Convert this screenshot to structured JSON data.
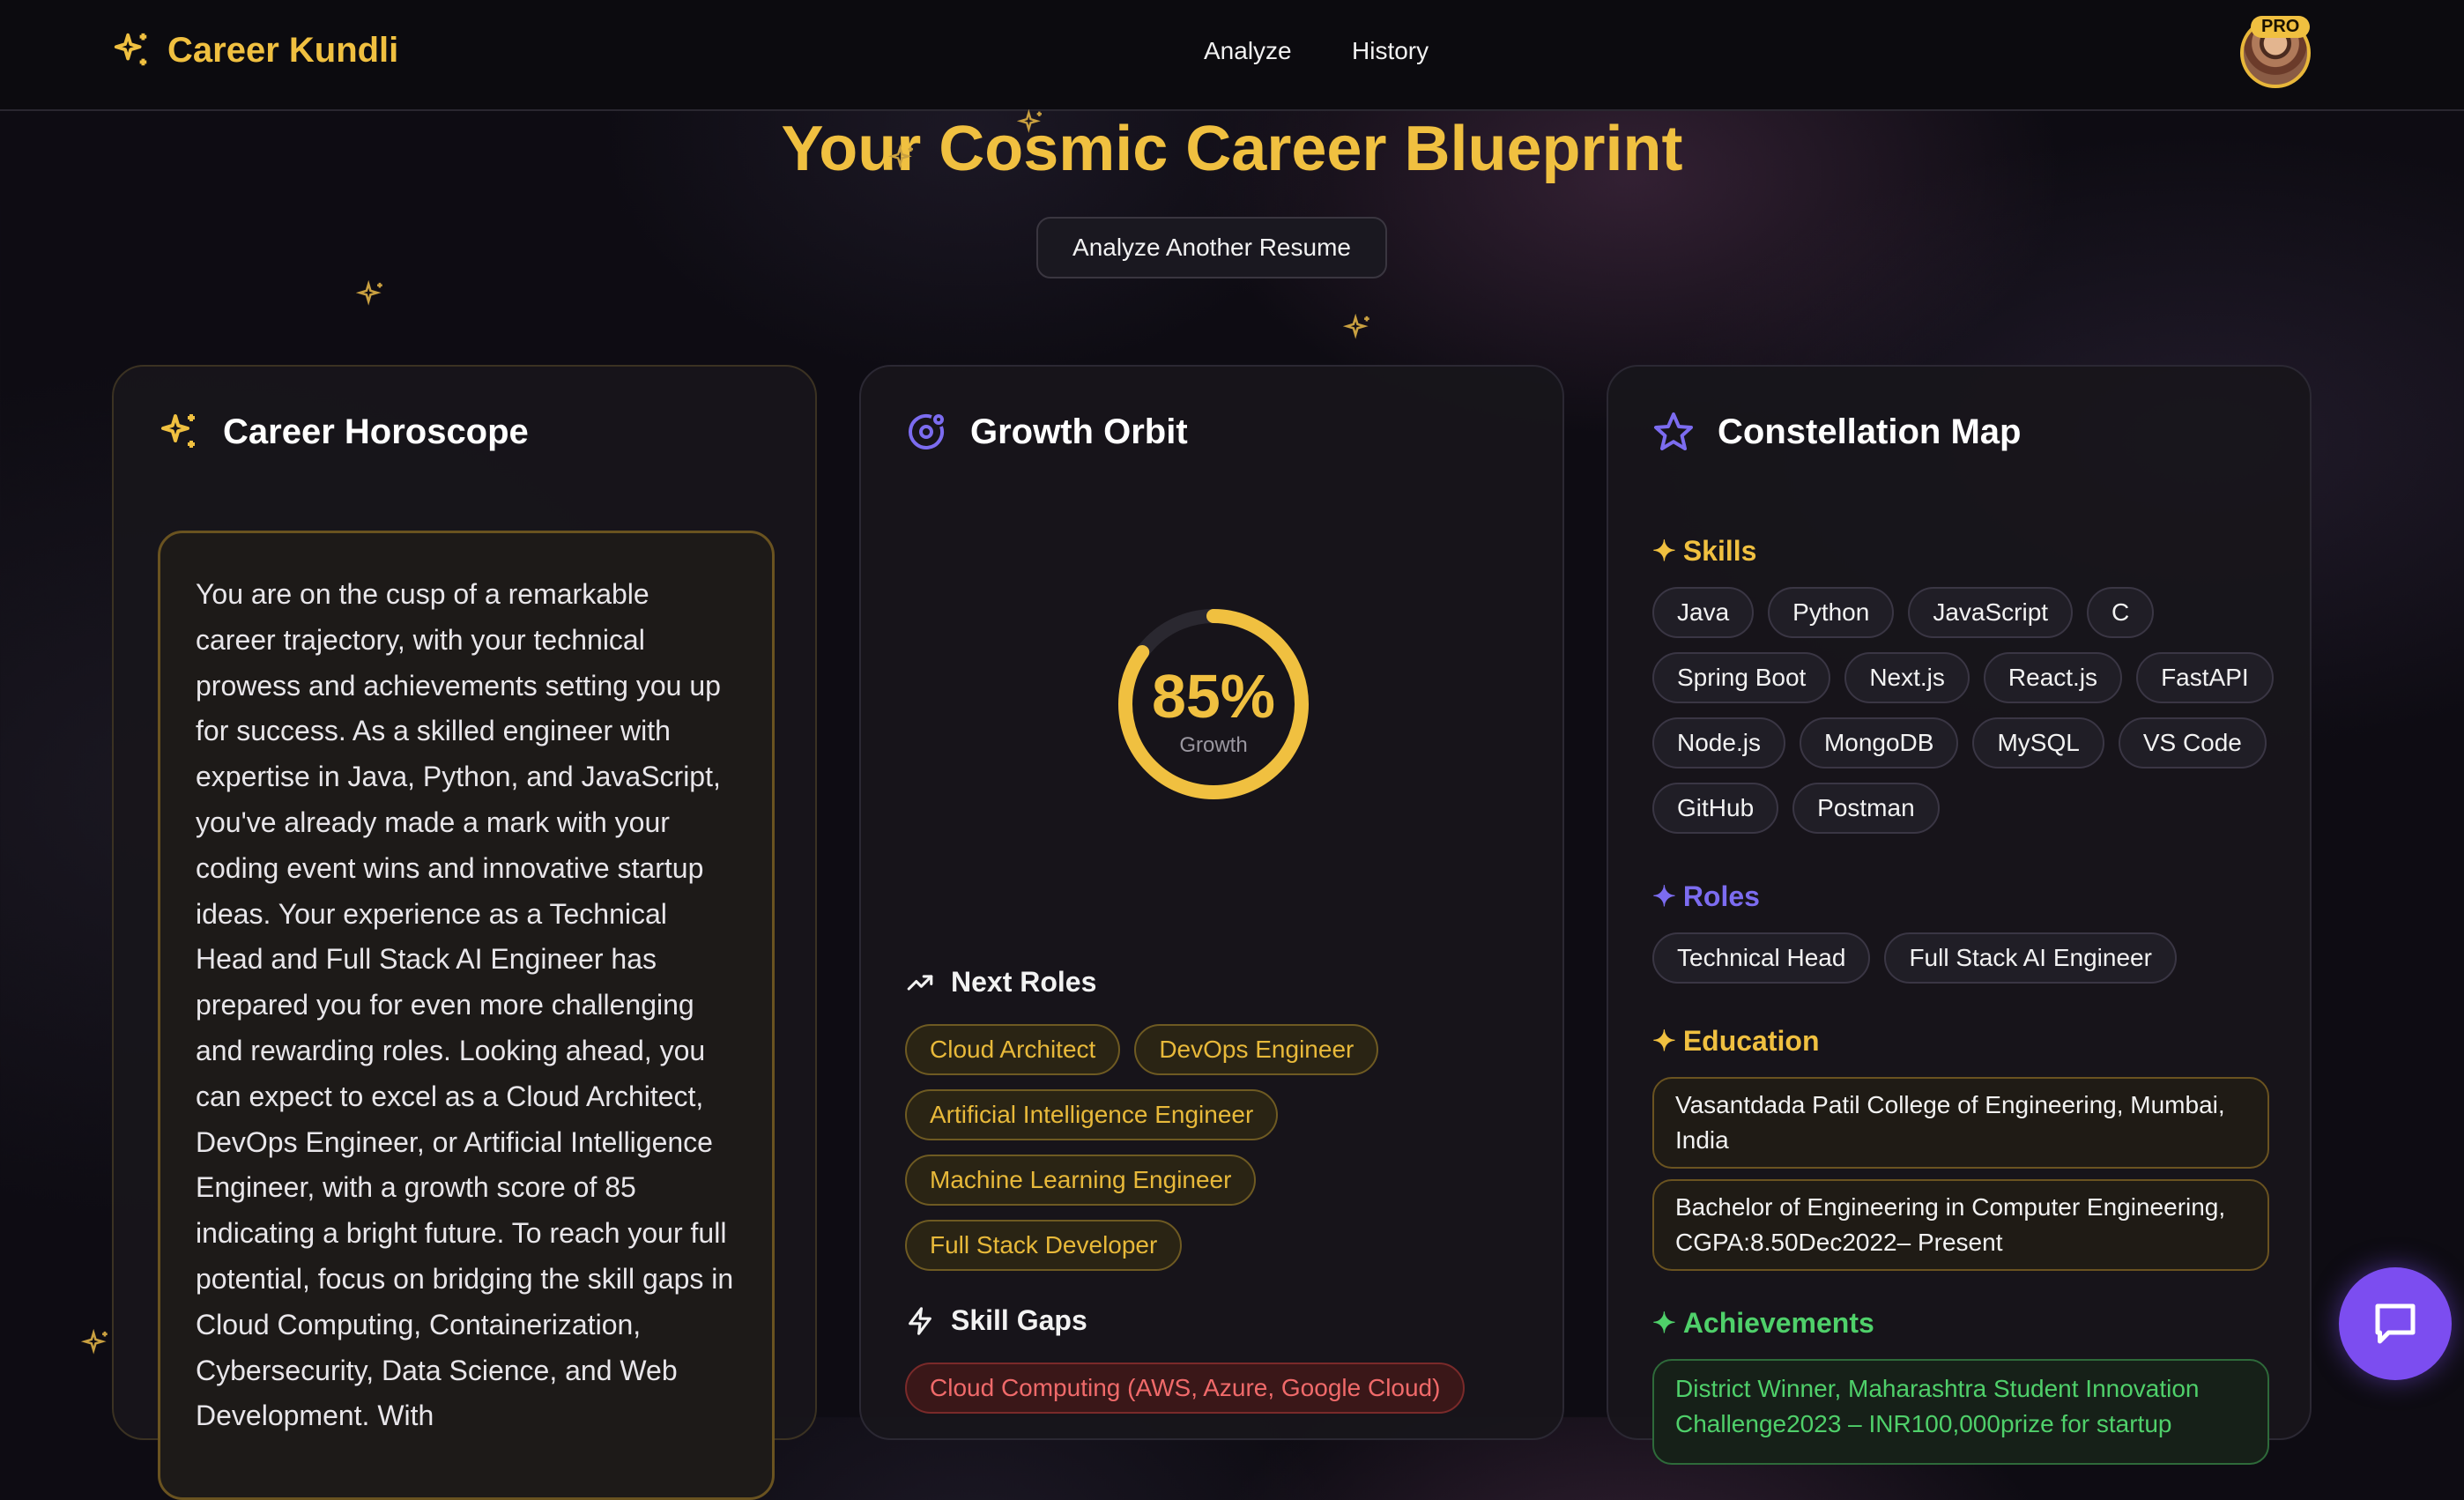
{
  "header": {
    "brand": "Career Kundli",
    "nav": [
      "Analyze",
      "History"
    ],
    "badge": "PRO"
  },
  "hero": {
    "title": "Your Cosmic Career Blueprint",
    "button": "Analyze Another Resume"
  },
  "horoscope": {
    "title": "Career Horoscope",
    "text": "You are on the cusp of a remarkable career trajectory, with your technical prowess and achievements setting you up for success. As a skilled engineer with expertise in Java, Python, and JavaScript, you've already made a mark with your coding event wins and innovative startup ideas. Your experience as a Technical Head and Full Stack AI Engineer has prepared you for even more challenging and rewarding roles. Looking ahead, you can expect to excel as a Cloud Architect, DevOps Engineer, or Artificial Intelligence Engineer, with a growth score of 85 indicating a bright future. To reach your full potential, focus on bridging the skill gaps in Cloud Computing, Containerization, Cybersecurity, Data Science, and Web Development. With"
  },
  "growth": {
    "title": "Growth Orbit",
    "score_text": "85%",
    "score_value": 85,
    "score_label": "Growth",
    "next_roles_title": "Next Roles",
    "next_roles": [
      "Cloud Architect",
      "DevOps Engineer",
      "Artificial Intelligence Engineer",
      "Machine Learning Engineer",
      "Full Stack Developer"
    ],
    "skill_gaps_title": "Skill Gaps",
    "skill_gaps": [
      "Cloud Computing (AWS, Azure, Google Cloud)"
    ]
  },
  "constellation": {
    "title": "Constellation Map",
    "skills_title": "Skills",
    "skills": [
      "Java",
      "Python",
      "JavaScript",
      "C",
      "Spring Boot",
      "Next.js",
      "React.js",
      "FastAPI",
      "Node.js",
      "MongoDB",
      "MySQL",
      "VS Code",
      "GitHub",
      "Postman"
    ],
    "roles_title": "Roles",
    "roles": [
      "Technical Head",
      "Full Stack AI Engineer"
    ],
    "education_title": "Education",
    "education": [
      "Vasantdada Patil College of Engineering, Mumbai, India",
      "Bachelor of Engineering in Computer Engineering, CGPA:8.50Dec2022– Present"
    ],
    "achievements_title": "Achievements",
    "achievements": [
      "District Winner, Maharashtra Student Innovation Challenge2023 – INR100,000prize for startup"
    ]
  },
  "colors": {
    "gold": "#f0c040",
    "purple": "#7c6cf0",
    "green": "#4fd06a",
    "red": "#f06a6a",
    "chat": "#7c4df0"
  },
  "icons": {
    "brand": "sparkles-icon",
    "horoscope": "sparkles-icon",
    "growth": "orbit-icon",
    "constellation": "star-icon",
    "next_roles": "trending-up-icon",
    "skill_gaps": "lightning-icon",
    "chat": "chat-icon"
  }
}
